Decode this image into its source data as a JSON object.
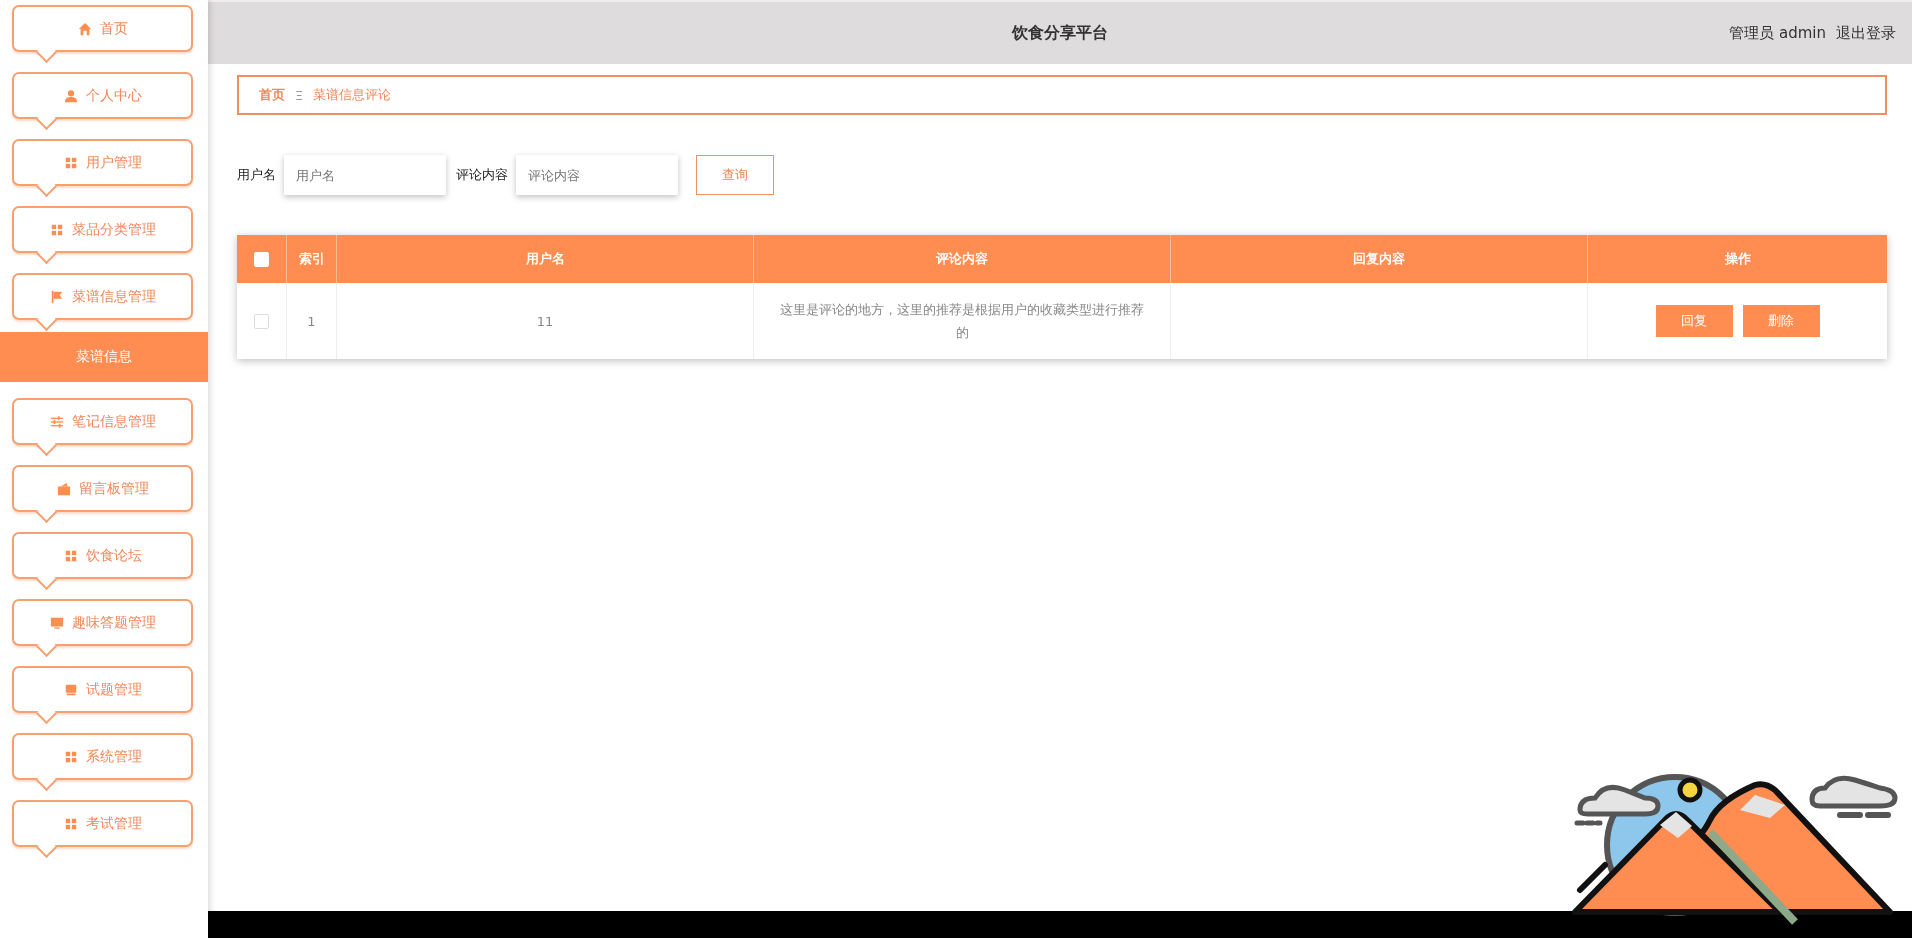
{
  "sidebar": {
    "items": [
      {
        "label": "首页"
      },
      {
        "label": "个人中心"
      },
      {
        "label": "用户管理"
      },
      {
        "label": "菜品分类管理"
      },
      {
        "label": "菜谱信息管理",
        "children": [
          {
            "label": "菜谱信息",
            "selected": true
          }
        ]
      },
      {
        "label": "笔记信息管理"
      },
      {
        "label": "留言板管理"
      },
      {
        "label": "饮食论坛"
      },
      {
        "label": "趣味答题管理"
      },
      {
        "label": "试题管理"
      },
      {
        "label": "系统管理"
      },
      {
        "label": "考试管理"
      }
    ]
  },
  "header": {
    "title": "饮食分享平台",
    "user": "管理员 admin",
    "logout": "退出登录"
  },
  "breadcrumb": {
    "home": "首页",
    "separator": "Ξ",
    "current": "菜谱信息评论"
  },
  "search": {
    "fields": [
      {
        "label": "用户名",
        "placeholder": "用户名"
      },
      {
        "label": "评论内容",
        "placeholder": "评论内容"
      }
    ],
    "button": "查询"
  },
  "table": {
    "columns": [
      "索引",
      "用户名",
      "评论内容",
      "回复内容",
      "操作"
    ],
    "all_checked": false,
    "rows": [
      {
        "checked": false,
        "index": "1",
        "username": "11",
        "comment": "这里是评论的地方，这里的推荐是根据用户的收藏类型进行推荐的",
        "actions": [
          "回复",
          "删除"
        ]
      }
    ]
  }
}
